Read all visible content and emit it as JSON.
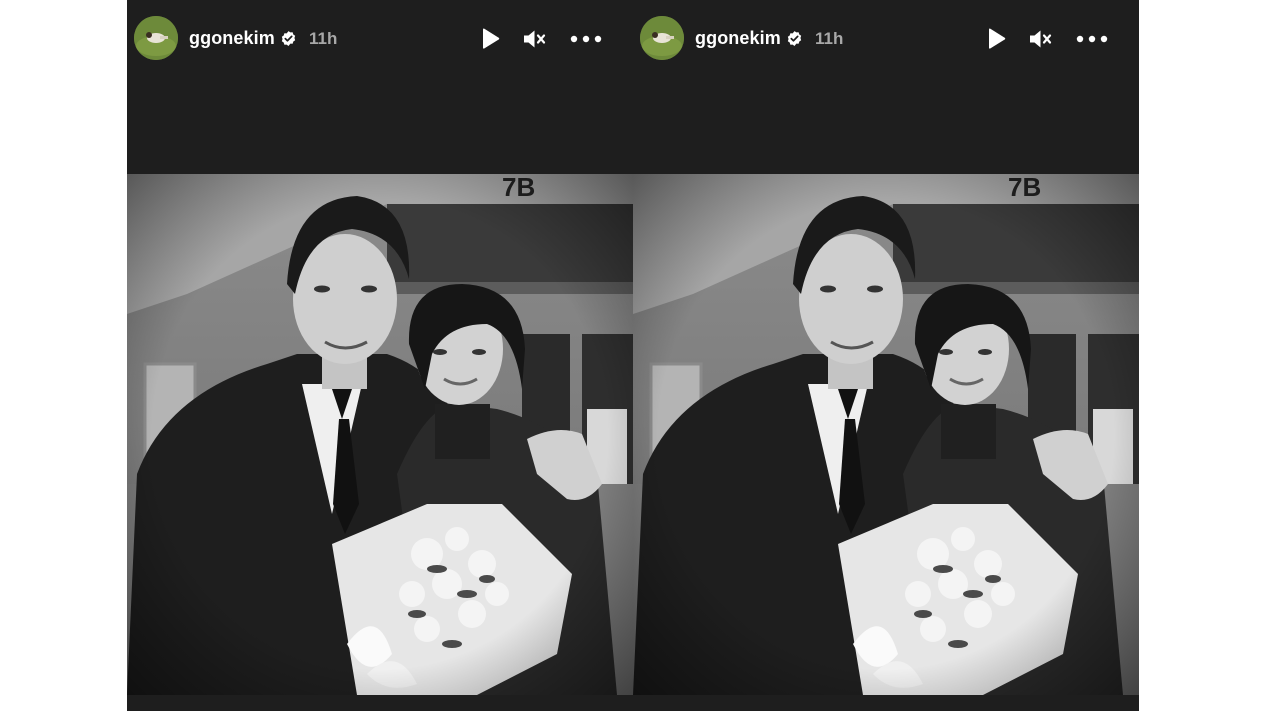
{
  "stories": [
    {
      "username": "ggonekim",
      "time": "11h",
      "verified": true,
      "avatar_icon": "profile-avatar",
      "controls": {
        "play_icon": "play-icon",
        "mute_icon": "muted-speaker-icon",
        "more_icon": "more-options-icon"
      },
      "photo": {
        "style": "black-and-white",
        "sign_text": "7B"
      }
    },
    {
      "username": "ggonekim",
      "time": "11h",
      "verified": true,
      "avatar_icon": "profile-avatar",
      "controls": {
        "play_icon": "play-icon",
        "mute_icon": "muted-speaker-icon",
        "more_icon": "more-options-icon"
      },
      "photo": {
        "style": "black-and-white",
        "sign_text": "7B"
      }
    }
  ],
  "colors": {
    "panel_bg": "#1e1e1e",
    "username": "#ffffff",
    "time": "#a8a8a8",
    "page_bg": "#ffffff"
  }
}
